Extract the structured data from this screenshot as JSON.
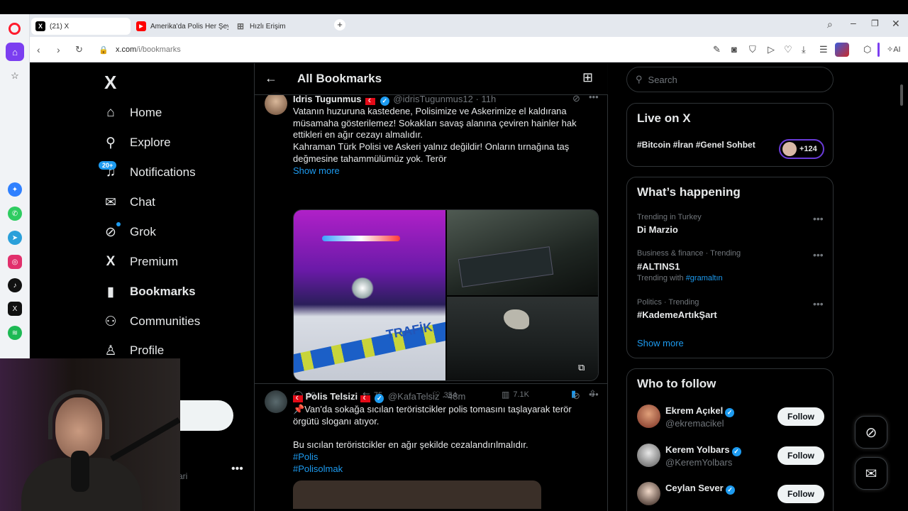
{
  "browser": {
    "tabs": [
      {
        "title": "(21) X",
        "icon": "x-favicon"
      },
      {
        "title": "Amerika'da Polis Her Şeyi",
        "icon": "youtube-favicon"
      },
      {
        "title": "Hızlı Erişim",
        "icon": "speed-dial-icon"
      }
    ],
    "url_domain": "x.com",
    "url_path": "/i/bookmarks",
    "ai_label": "AI"
  },
  "sidebar": {
    "logo": "X",
    "notifications_badge": "20+",
    "items": [
      {
        "label": "Home",
        "icon": "home-icon"
      },
      {
        "label": "Explore",
        "icon": "search-icon"
      },
      {
        "label": "Notifications",
        "icon": "bell-icon"
      },
      {
        "label": "Chat",
        "icon": "mail-icon"
      },
      {
        "label": "Grok",
        "icon": "grok-icon"
      },
      {
        "label": "Premium",
        "icon": "x-icon"
      },
      {
        "label": "Bookmarks",
        "icon": "bookmark-icon"
      },
      {
        "label": "Communities",
        "icon": "people-icon"
      },
      {
        "label": "Profile",
        "icon": "person-icon"
      }
    ],
    "account_name_partial": "i",
    "account_handle_partial": "ari"
  },
  "timeline": {
    "title": "All Bookmarks",
    "tweets": [
      {
        "name": "Idris Tugunmus",
        "handle": "@idrisTugunmus12",
        "time": "11h",
        "text": "Vatanın huzuruna kastedene, Polisimize ve Askerimize el kaldırana müsamaha gösterilemez! Sokakları savaş alanına çeviren hainler hak ettikleri en ağır cezayı almalıdır.\nKahraman Türk Polisi ve Askeri yalnız değildir! Onların tırnağına taş değmesine tahammülümüz yok. Terör",
        "show_more": "Show more",
        "image_text": "TRAFİK",
        "replies": "10",
        "reposts": "75",
        "likes": "354",
        "views": "7.1K"
      },
      {
        "name": "Polis Telsizi",
        "handle": "@KafaTelsiz",
        "time": "48m",
        "text_line1": "📌Van'da sokağa sıcılan teröristcikler polis tomasını taşlayarak terör örgütü sloganı atıyor.",
        "text_line2": "Bu sıcılan teröristcikler en ağır şekilde cezalandırılmalıdır.",
        "hashtag1": "#Polis",
        "hashtag2": "#Polisolmak"
      }
    ]
  },
  "right": {
    "search_placeholder": "Search",
    "live": {
      "title": "Live on X",
      "topics": "#Bitcoin #İran #Genel Sohbet",
      "count": "+124"
    },
    "happening": {
      "title": "What’s happening",
      "trends": [
        {
          "context": "Trending in Turkey",
          "name": "Di Marzio",
          "extra": ""
        },
        {
          "context": "Business & finance · Trending",
          "name": "#ALTINS1",
          "extra_prefix": "Trending with",
          "extra": "#gramaltın"
        },
        {
          "context": "Politics · Trending",
          "name": "#KademeArtıkŞart",
          "extra": ""
        }
      ],
      "show_more": "Show more"
    },
    "who_to_follow": {
      "title": "Who to follow",
      "users": [
        {
          "name": "Ekrem Açıkel",
          "handle": "@ekremacikel",
          "button": "Follow"
        },
        {
          "name": "Kerem Yolbars",
          "handle": "@KeremYolbars",
          "button": "Follow"
        },
        {
          "name": "Ceylan Sever",
          "handle": "",
          "button": "Follow"
        }
      ]
    }
  },
  "colors": {
    "accent": "#1d9bf0",
    "opera_red": "#ff1b2d",
    "background": "#000000"
  }
}
